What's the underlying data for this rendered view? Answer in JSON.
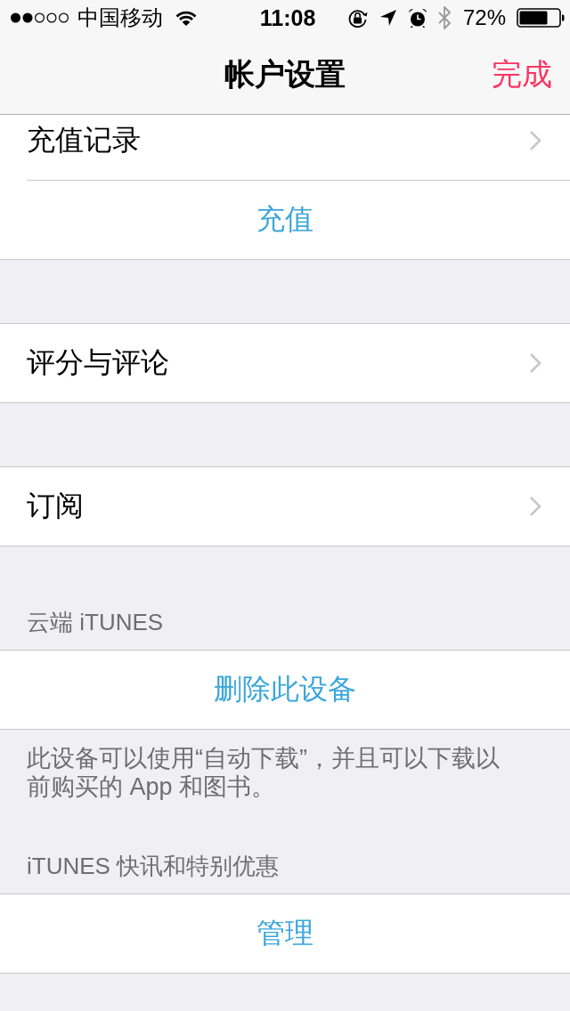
{
  "status_bar": {
    "carrier": "中国移动",
    "time": "11:08",
    "battery": "72%"
  },
  "nav_bar": {
    "title": "帐户设置",
    "done_button": "完成"
  },
  "sections": [
    {
      "rows": [
        {
          "kind": "link",
          "label": "充值记录"
        },
        {
          "kind": "action",
          "label": "充值"
        }
      ]
    },
    {
      "rows": [
        {
          "kind": "link",
          "label": "评分与评论"
        }
      ]
    },
    {
      "rows": [
        {
          "kind": "link",
          "label": "订阅"
        }
      ]
    },
    {
      "header": "云端 iTUNES",
      "rows": [
        {
          "kind": "action",
          "label": "删除此设备"
        }
      ],
      "footer": "此设备可以使用“自动下载”，并且可以下载以前购买的 App 和图书。"
    },
    {
      "header": "iTUNES 快讯和特别优惠",
      "rows": [
        {
          "kind": "action",
          "label": "管理"
        }
      ]
    }
  ]
}
